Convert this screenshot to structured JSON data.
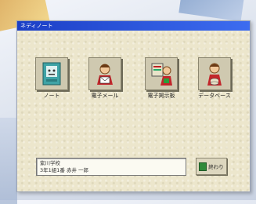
{
  "window": {
    "title": "ネディノート"
  },
  "apps": [
    {
      "label": "ノート",
      "icon": "notebook-icon"
    },
    {
      "label": "電子メール",
      "icon": "email-icon"
    },
    {
      "label": "電子掲示板",
      "icon": "bulletin-board-icon"
    },
    {
      "label": "データベース",
      "icon": "database-icon"
    }
  ],
  "info": {
    "line1": "紫川学校",
    "line2": "3年1組1番 赤井 一郎"
  },
  "end_button": {
    "label": "終わり",
    "icon": "exit-door-icon"
  },
  "colors": {
    "titlebar": "#2a55e0",
    "client": "#ece6cc"
  }
}
